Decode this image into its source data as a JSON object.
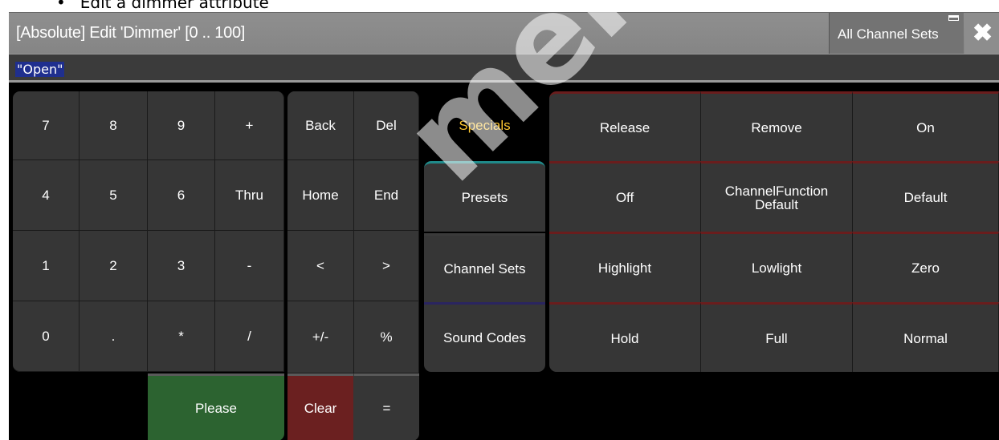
{
  "doc_bullet": {
    "bullet": "•",
    "text": "Edit a dimmer attribute"
  },
  "window": {
    "title": "[Absolute] Edit 'Dimmer' [0 .. 100]",
    "channel_sets_button": "All Channel Sets",
    "close_glyph": "✖"
  },
  "input": {
    "value": "\"Open\""
  },
  "keypad": {
    "rows": [
      [
        "7",
        "8",
        "9",
        "+"
      ],
      [
        "4",
        "5",
        "6",
        "Thru"
      ],
      [
        "1",
        "2",
        "3",
        "-"
      ],
      [
        "0",
        ".",
        "*",
        "/"
      ]
    ],
    "please": "Please"
  },
  "nav": {
    "rows": [
      [
        "Back",
        "Del"
      ],
      [
        "Home",
        "End"
      ],
      [
        "<",
        ">"
      ],
      [
        "+/-",
        "%"
      ]
    ],
    "clear": "Clear",
    "equals": "="
  },
  "categories": [
    {
      "label": "Specials",
      "active": true
    },
    {
      "label": "Presets",
      "active": false
    },
    {
      "label": "Channel Sets",
      "active": false
    },
    {
      "label": "Sound Codes",
      "active": false
    }
  ],
  "specials": [
    [
      "Release",
      "Remove",
      "On"
    ],
    [
      "Off",
      "ChannelFunction Default",
      "Default"
    ],
    [
      "Highlight",
      "Lowlight",
      "Zero"
    ],
    [
      "Hold",
      "Full",
      "Normal"
    ]
  ],
  "watermark": "mendoza.co",
  "colors": {
    "active_category": "#ffc832",
    "please": "#2c6330",
    "clear": "#6b2020",
    "input_highlight": "#1f2f8f"
  }
}
